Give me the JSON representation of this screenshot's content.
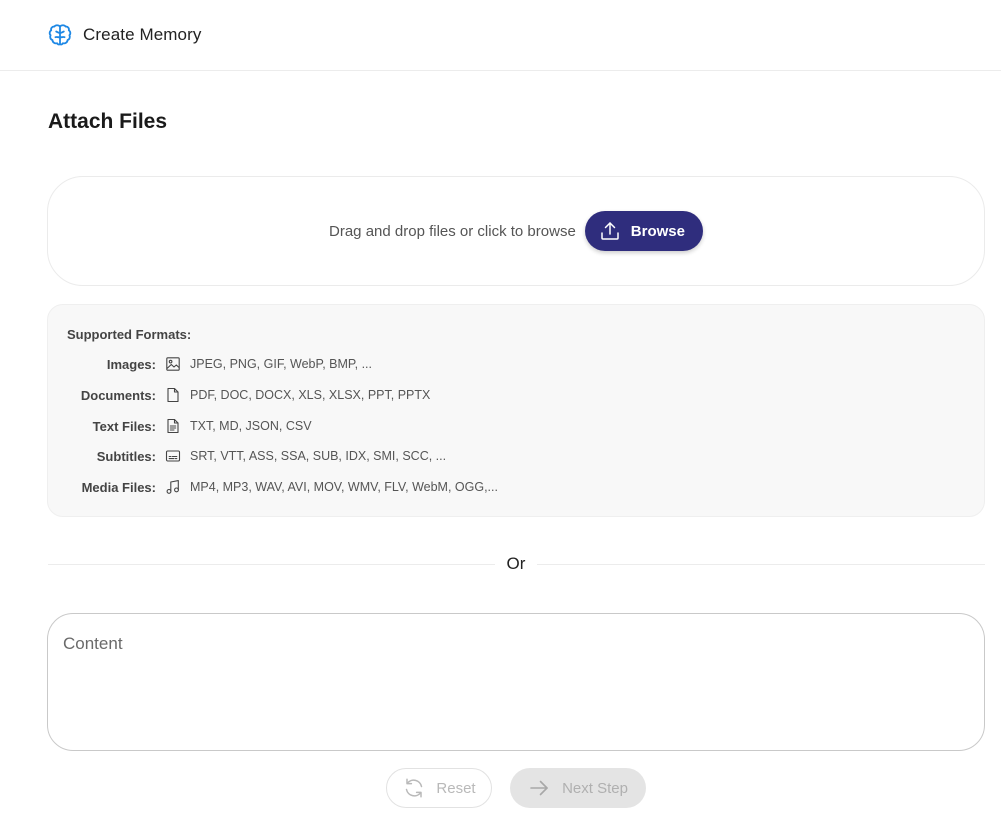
{
  "header": {
    "logo_icon": "brain-icon",
    "title": "Create Memory",
    "accent_color": "#1e88e5"
  },
  "page": {
    "title": "Attach Files"
  },
  "dropzone": {
    "hint": "Drag and drop files or click to browse",
    "browse_label": "Browse",
    "browse_icon": "upload-icon",
    "browse_color": "#2f2d7d"
  },
  "formats": {
    "title": "Supported Formats:",
    "rows": [
      {
        "label": "Images:",
        "icon": "image-icon",
        "value": "JPEG, PNG, GIF, WebP, BMP, ..."
      },
      {
        "label": "Documents:",
        "icon": "document-icon",
        "value": "PDF, DOC, DOCX, XLS, XLSX, PPT, PPTX"
      },
      {
        "label": "Text Files:",
        "icon": "text-file-icon",
        "value": "TXT, MD, JSON, CSV"
      },
      {
        "label": "Subtitles:",
        "icon": "subtitles-icon",
        "value": "SRT, VTT, ASS, SSA, SUB, IDX, SMI, SCC, ..."
      },
      {
        "label": "Media Files:",
        "icon": "music-note-icon",
        "value": "MP4, MP3, WAV, AVI, MOV, WMV, FLV, WebM, OGG,..."
      }
    ]
  },
  "separator": {
    "label": "Or"
  },
  "content": {
    "placeholder": "Content",
    "value": ""
  },
  "actions": {
    "reset_label": "Reset",
    "reset_icon": "refresh-icon",
    "next_label": "Next Step",
    "next_icon": "arrow-right-icon"
  }
}
